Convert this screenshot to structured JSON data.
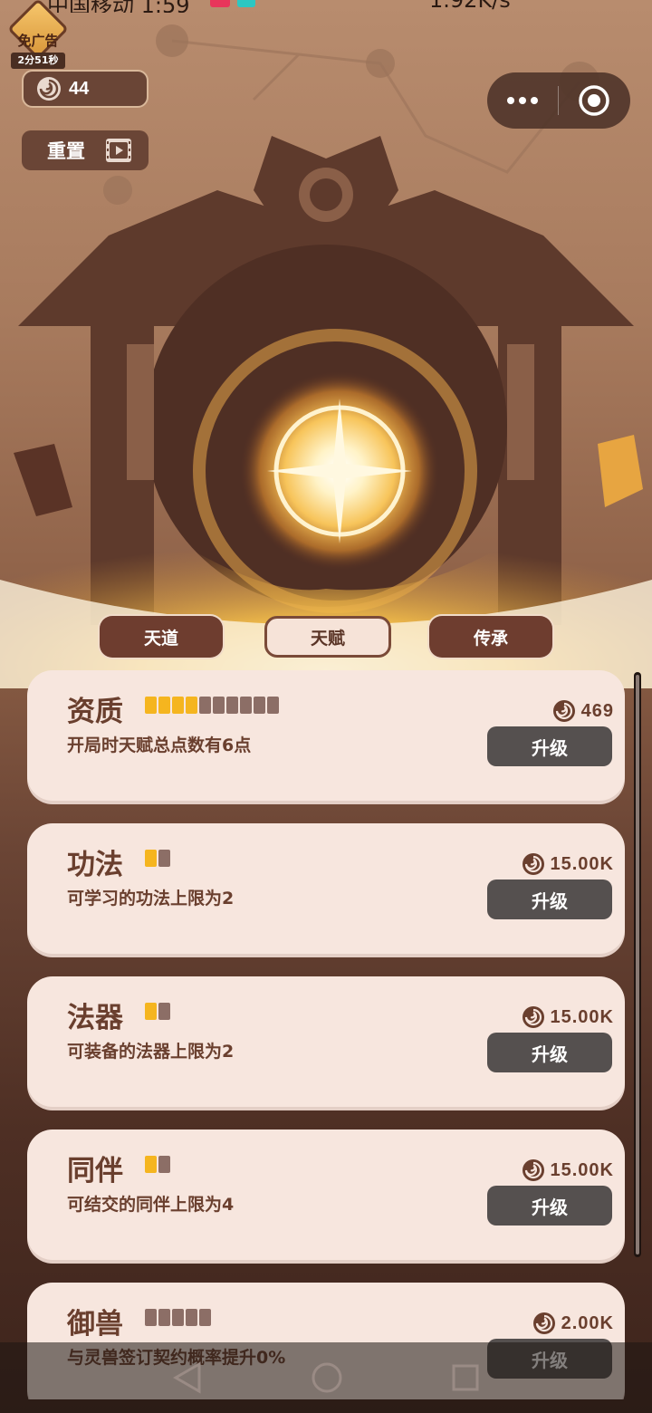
{
  "status_bar": {
    "left_text": "中国移动 1:59",
    "right_text": "1.92K/s"
  },
  "colors": {
    "accent": "#f5b51f",
    "card_bg": "#f7e6de",
    "button_bg": "#55504f",
    "tab_active_bg": "#f6e3d8",
    "tab_inactive_bg": "#6e3d2f"
  },
  "no_ad": {
    "label": "免广告",
    "timer": "2分51秒"
  },
  "currency": {
    "icon": "swirl-coin-icon",
    "amount": "44"
  },
  "reset": {
    "label": "重置",
    "icon": "video-ad-icon"
  },
  "capsule": {
    "more_icon": "more-dots-icon",
    "close_icon": "target-close-icon"
  },
  "tabs": [
    {
      "label": "天道",
      "active": false
    },
    {
      "label": "天赋",
      "active": true
    },
    {
      "label": "传承",
      "active": false
    }
  ],
  "talents": [
    {
      "title": "资质",
      "level": 4,
      "max": 10,
      "desc": "开局时天赋总点数有6点",
      "cost": "469",
      "button": "升级"
    },
    {
      "title": "功法",
      "level": 1,
      "max": 2,
      "desc": "可学习的功法上限为2",
      "cost": "15.00K",
      "button": "升级"
    },
    {
      "title": "法器",
      "level": 1,
      "max": 2,
      "desc": "可装备的法器上限为2",
      "cost": "15.00K",
      "button": "升级"
    },
    {
      "title": "同伴",
      "level": 1,
      "max": 2,
      "desc": "可结交的同伴上限为4",
      "cost": "15.00K",
      "button": "升级"
    },
    {
      "title": "御兽",
      "level": 0,
      "max": 5,
      "desc": "与灵兽签订契约概率提升0%",
      "cost": "2.00K",
      "button": "升级"
    }
  ],
  "nav": {
    "back_icon": "back-triangle-icon",
    "home_icon": "home-circle-icon",
    "recents_icon": "recents-square-icon"
  }
}
